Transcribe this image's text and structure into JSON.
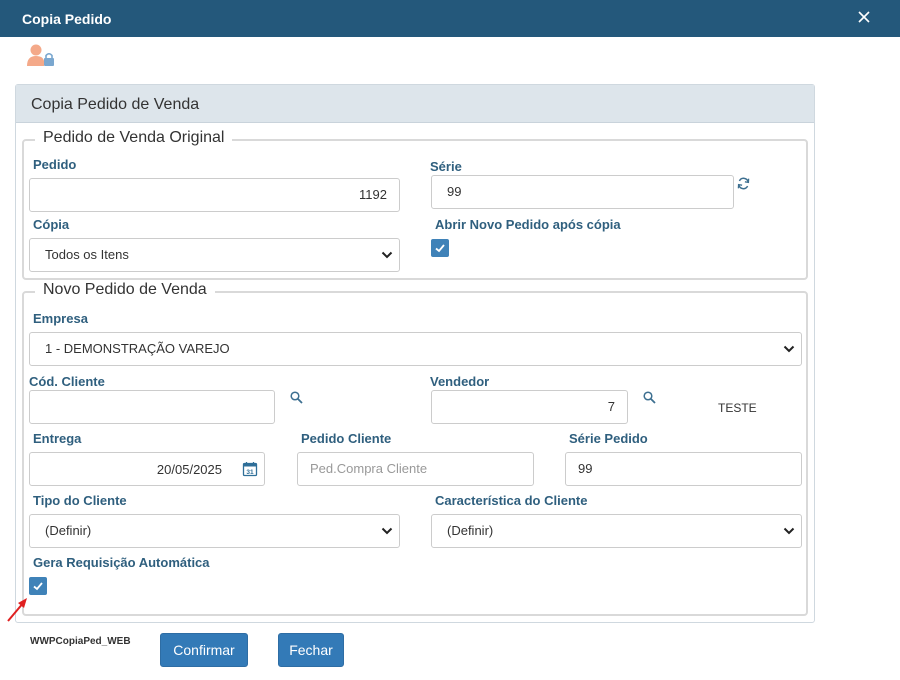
{
  "window": {
    "title": "Copia Pedido"
  },
  "panel": {
    "title": "Copia Pedido de Venda"
  },
  "original": {
    "legend": "Pedido de Venda Original",
    "pedido_label": "Pedido",
    "pedido_value": "1192",
    "serie_label": "Série",
    "serie_value": "99",
    "copia_label": "Cópia",
    "copia_value": "Todos os Itens",
    "abrir_label": "Abrir Novo Pedido após cópia"
  },
  "novo": {
    "legend": "Novo Pedido de Venda",
    "empresa_label": "Empresa",
    "empresa_value": "1 - DEMONSTRAÇÃO VAREJO",
    "cod_cliente_label": "Cód. Cliente",
    "cod_cliente_value": "",
    "vendedor_label": "Vendedor",
    "vendedor_value": "7",
    "vendedor_name": "TESTE",
    "entrega_label": "Entrega",
    "entrega_value": "20/05/2025",
    "pedido_cliente_label": "Pedido Cliente",
    "pedido_cliente_placeholder": "Ped.Compra  Cliente",
    "serie_pedido_label": "Série Pedido",
    "serie_pedido_value": "99",
    "tipo_cliente_label": "Tipo do Cliente",
    "tipo_cliente_value": "(Definir)",
    "caracteristica_label": "Característica do Cliente",
    "caracteristica_value": "(Definir)",
    "gera_label": "Gera Requisição Automática"
  },
  "footer": {
    "form_id": "WWPCopiaPed_WEB",
    "confirm_label": "Confirmar",
    "close_label": "Fechar"
  },
  "colors": {
    "titlebar": "#24587b",
    "accent": "#337ab7",
    "label": "#2f5f7e",
    "checkbox": "#3f82b8",
    "annotation_arrow": "#e02020"
  }
}
